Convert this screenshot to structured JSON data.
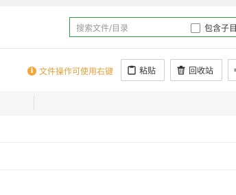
{
  "search": {
    "placeholder": "搜索文件/目录",
    "include_subdirs_label": "包含子目"
  },
  "toolbar": {
    "tip_icon": "info-icon",
    "tip_text": "文件操作可使用右键",
    "paste_label": "粘贴",
    "recycle_label": "回收站"
  },
  "colors": {
    "search_border": "#2e9e3e",
    "tip": "#e4a13b"
  }
}
